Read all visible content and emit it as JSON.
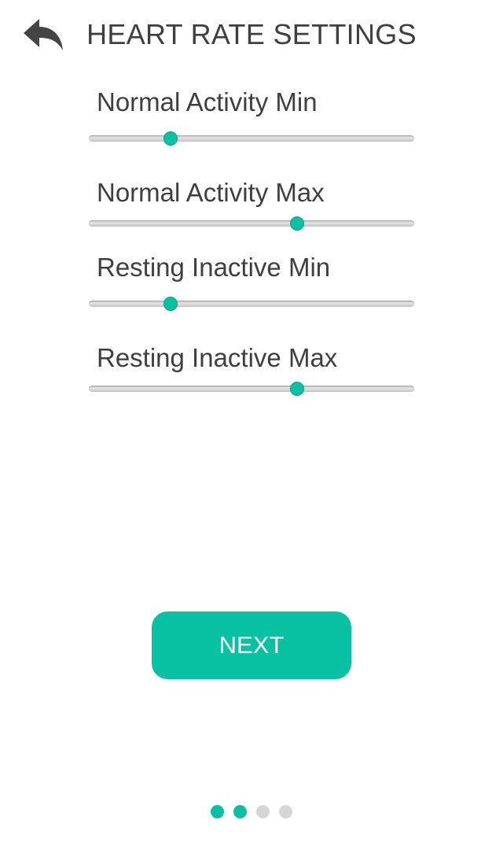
{
  "header": {
    "back_icon": "reply-arrow-icon",
    "title": "HEART RATE SETTINGS"
  },
  "sliders": [
    {
      "label": "Normal Activity Min",
      "fraction": 0.25
    },
    {
      "label": "Normal Activity Max",
      "fraction": 0.64
    },
    {
      "label": "Resting Inactive Min",
      "fraction": 0.25
    },
    {
      "label": "Resting Inactive Max",
      "fraction": 0.64
    }
  ],
  "next_button": {
    "label": "NEXT"
  },
  "pagination": {
    "total": 4,
    "current": 2
  },
  "colors": {
    "accent": "#08c1a3",
    "inactive_dot": "#d6d6d6",
    "text": "#3f3f3f",
    "track": "#d3d3d3"
  }
}
